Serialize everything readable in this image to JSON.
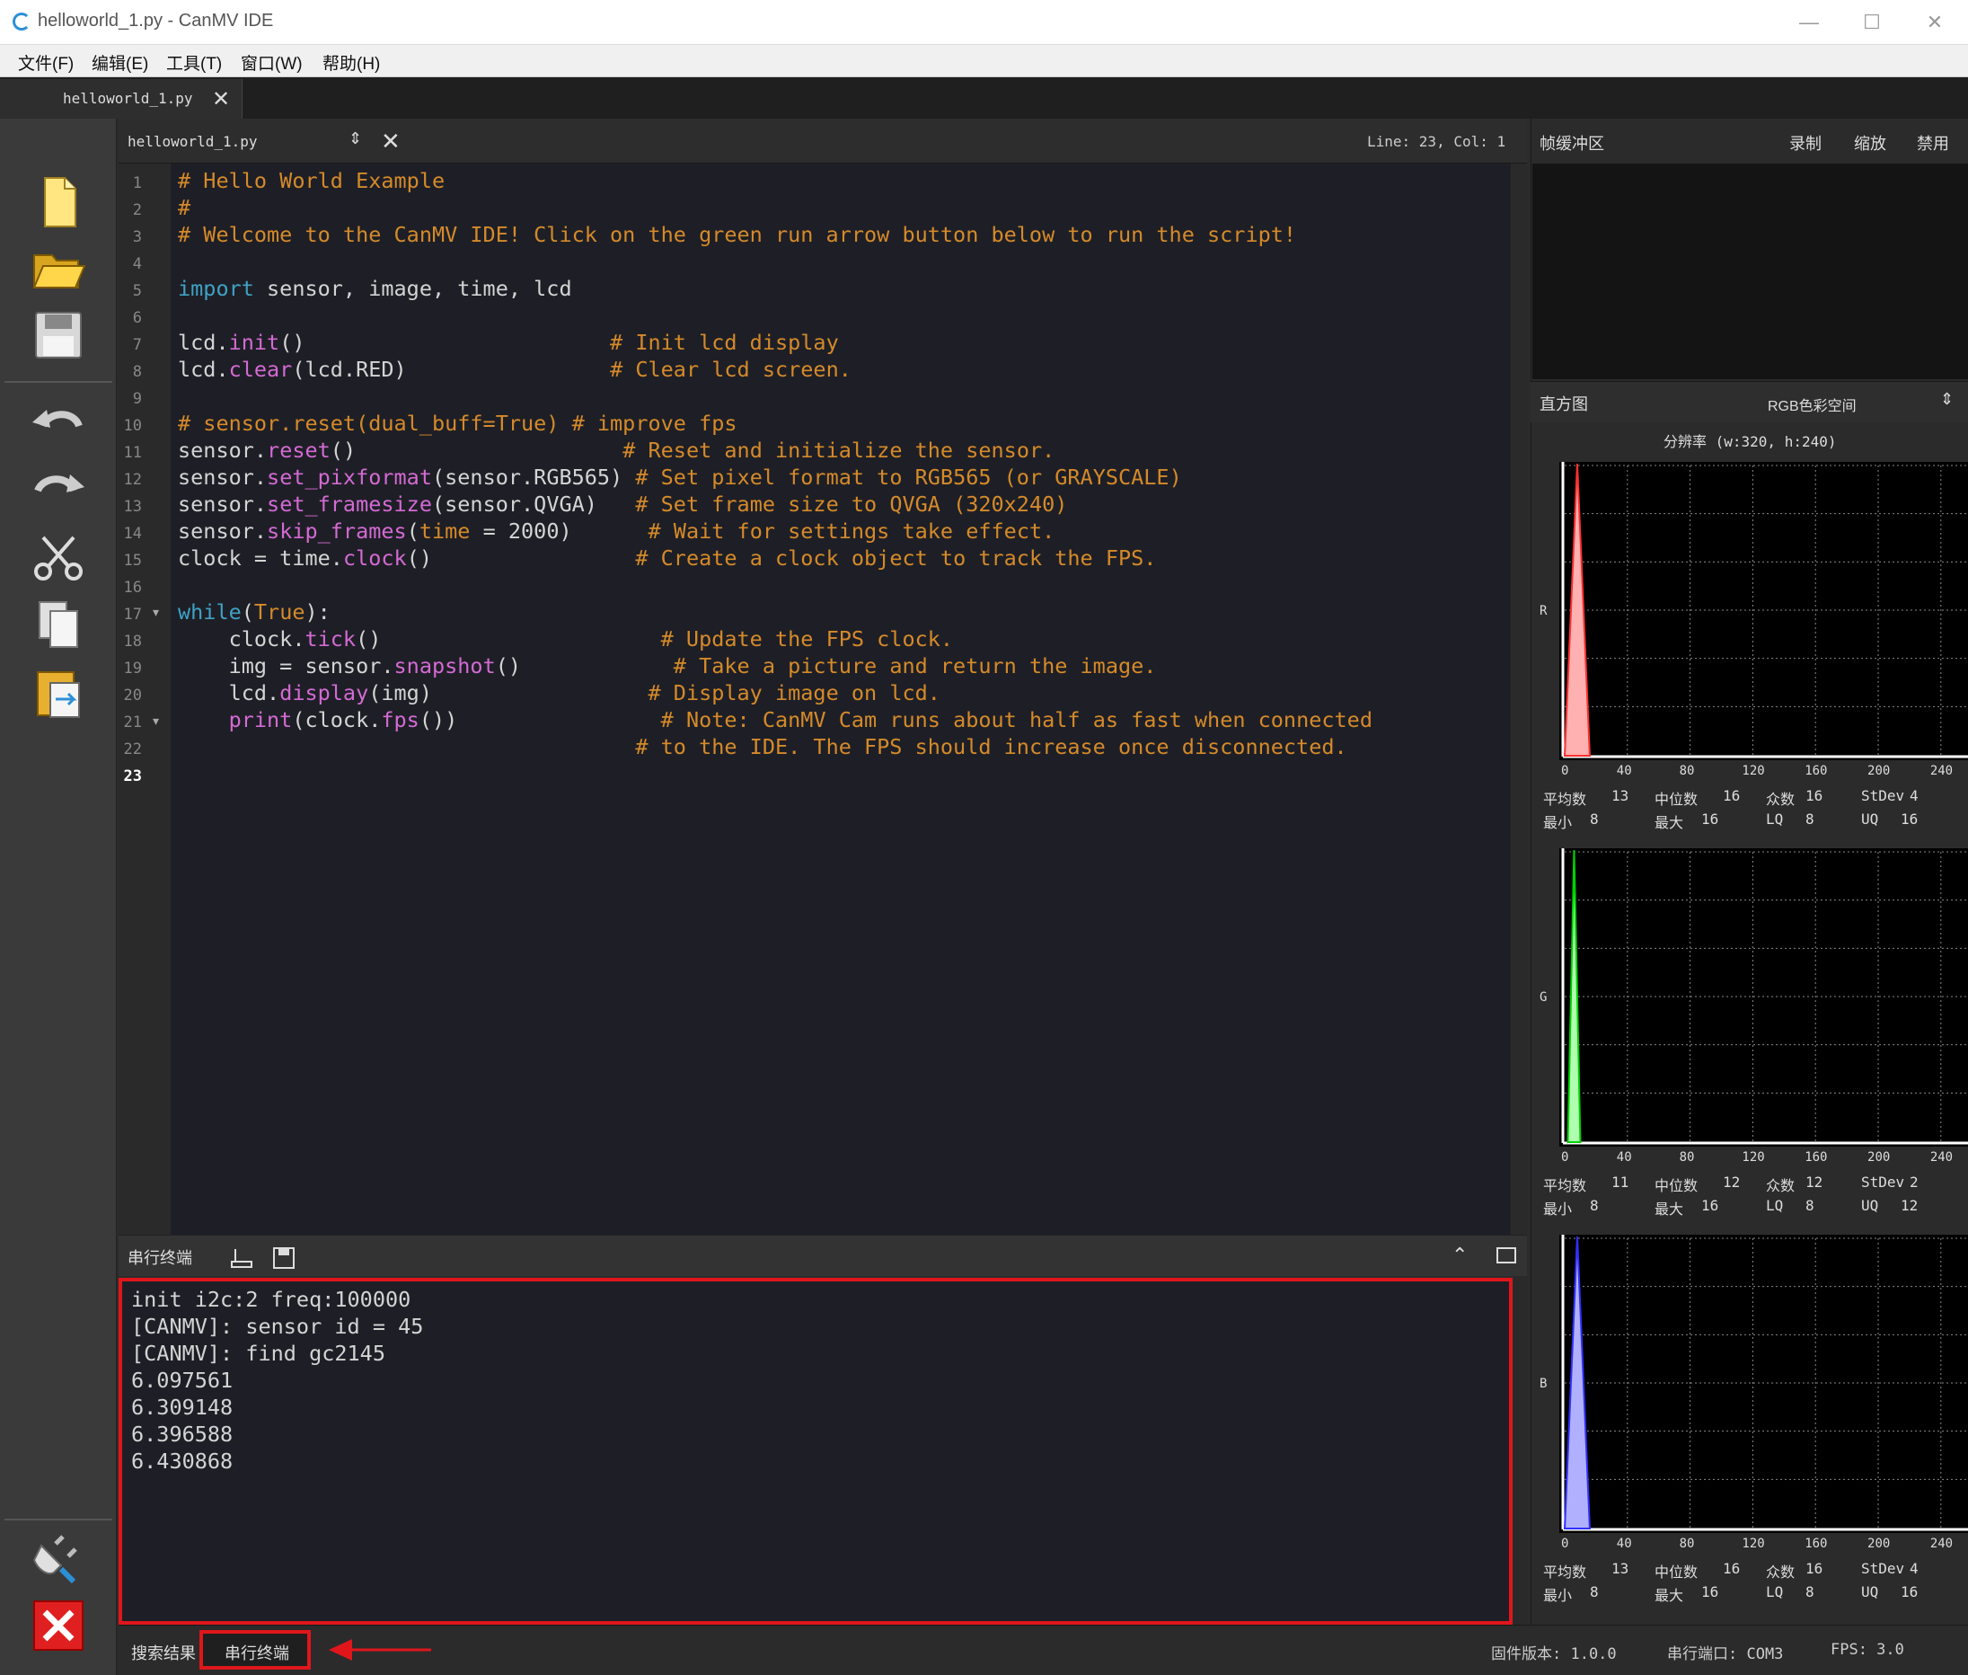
{
  "window": {
    "title": "helloworld_1.py - CanMV IDE"
  },
  "menu": [
    "文件(F)",
    "编辑(E)",
    "工具(T)",
    "窗口(W)",
    "帮助(H)"
  ],
  "tab": {
    "label": "helloworld_1.py"
  },
  "editor": {
    "file": "helloworld_1.py",
    "position": "Line: 23, Col: 1",
    "line_numbers": [
      "1",
      "2",
      "3",
      "4",
      "5",
      "6",
      "7",
      "8",
      "9",
      "10",
      "11",
      "12",
      "13",
      "14",
      "15",
      "16",
      "17",
      "18",
      "19",
      "20",
      "21",
      "22",
      "23"
    ],
    "lines": [
      [
        {
          "t": "# Hello World Example",
          "k": "c"
        }
      ],
      [
        {
          "t": "#",
          "k": "c"
        }
      ],
      [
        {
          "t": "# Welcome to the CanMV IDE! Click on the green run arrow button below to run the script!",
          "k": "c"
        }
      ],
      [],
      [
        {
          "t": "import",
          "k": "k"
        },
        {
          "t": " sensor, image, time, lcd",
          "k": "d"
        }
      ],
      [],
      [
        {
          "t": "lcd.",
          "k": "d"
        },
        {
          "t": "init",
          "k": "f"
        },
        {
          "t": "()                        ",
          "k": "d"
        },
        {
          "t": "# Init lcd display",
          "k": "c"
        }
      ],
      [
        {
          "t": "lcd.",
          "k": "d"
        },
        {
          "t": "clear",
          "k": "f"
        },
        {
          "t": "(lcd.RED)                ",
          "k": "d"
        },
        {
          "t": "# Clear lcd screen.",
          "k": "c"
        }
      ],
      [],
      [
        {
          "t": "# sensor.reset(dual_buff=True) # improve fps",
          "k": "c"
        }
      ],
      [
        {
          "t": "sensor.",
          "k": "d"
        },
        {
          "t": "reset",
          "k": "f"
        },
        {
          "t": "()                     ",
          "k": "d"
        },
        {
          "t": "# Reset and initialize the sensor.",
          "k": "c"
        }
      ],
      [
        {
          "t": "sensor.",
          "k": "d"
        },
        {
          "t": "set_pixformat",
          "k": "f"
        },
        {
          "t": "(sensor.RGB565) ",
          "k": "d"
        },
        {
          "t": "# Set pixel format to RGB565 (or GRAYSCALE)",
          "k": "c"
        }
      ],
      [
        {
          "t": "sensor.",
          "k": "d"
        },
        {
          "t": "set_framesize",
          "k": "f"
        },
        {
          "t": "(sensor.QVGA)   ",
          "k": "d"
        },
        {
          "t": "# Set frame size to QVGA (320x240)",
          "k": "c"
        }
      ],
      [
        {
          "t": "sensor.",
          "k": "d"
        },
        {
          "t": "skip_frames",
          "k": "f"
        },
        {
          "t": "(",
          "k": "d"
        },
        {
          "t": "time",
          "k": "n"
        },
        {
          "t": " = 2000)      ",
          "k": "d"
        },
        {
          "t": "# Wait for settings take effect.",
          "k": "c"
        }
      ],
      [
        {
          "t": "clock = time.",
          "k": "d"
        },
        {
          "t": "clock",
          "k": "f"
        },
        {
          "t": "()                ",
          "k": "d"
        },
        {
          "t": "# Create a clock object to track the FPS.",
          "k": "c"
        }
      ],
      [],
      [
        {
          "t": "while",
          "k": "k"
        },
        {
          "t": "(",
          "k": "d"
        },
        {
          "t": "True",
          "k": "n"
        },
        {
          "t": "):",
          "k": "d"
        }
      ],
      [
        {
          "t": "    clock.",
          "k": "d"
        },
        {
          "t": "tick",
          "k": "f"
        },
        {
          "t": "()                      ",
          "k": "d"
        },
        {
          "t": "# Update the FPS clock.",
          "k": "c"
        }
      ],
      [
        {
          "t": "    img = sensor.",
          "k": "d"
        },
        {
          "t": "snapshot",
          "k": "f"
        },
        {
          "t": "()            ",
          "k": "d"
        },
        {
          "t": "# Take a picture and return the image.",
          "k": "c"
        }
      ],
      [
        {
          "t": "    lcd.",
          "k": "d"
        },
        {
          "t": "display",
          "k": "f"
        },
        {
          "t": "(img)                 ",
          "k": "d"
        },
        {
          "t": "# Display image on lcd.",
          "k": "c"
        }
      ],
      [
        {
          "t": "    ",
          "k": "d"
        },
        {
          "t": "print",
          "k": "f"
        },
        {
          "t": "(clock.",
          "k": "d"
        },
        {
          "t": "fps",
          "k": "f"
        },
        {
          "t": "())                ",
          "k": "d"
        },
        {
          "t": "# Note: CanMV Cam runs about half as fast when connected",
          "k": "c"
        }
      ],
      [
        {
          "t": "                                    ",
          "k": "d"
        },
        {
          "t": "# to the IDE. The FPS should increase once disconnected.",
          "k": "c"
        }
      ],
      []
    ]
  },
  "terminal": {
    "label": "串行终端",
    "lines": [
      "init i2c:2 freq:100000",
      "[CANMV]: sensor id = 45",
      "[CANMV]: find gc2145",
      "6.097561",
      "6.309148",
      "6.396588",
      "6.430868"
    ]
  },
  "statusbar": {
    "search": "搜索结果",
    "serial": "串行终端",
    "firmware": "固件版本: 1.0.0",
    "port": "串行端口: COM3",
    "fps": "FPS:  3.0"
  },
  "framebuffer": {
    "label": "帧缓冲区",
    "record": "录制",
    "zoom": "缩放",
    "disable": "禁用"
  },
  "histogram": {
    "label": "直方图",
    "colorspace": "RGB色彩空间",
    "resolution": "分辨率 (w:320, h:240)",
    "x_ticks": [
      "0",
      "40",
      "80",
      "120",
      "160",
      "200",
      "240"
    ],
    "stat_labels": {
      "mean": "平均数",
      "median": "中位数",
      "mode": "众数",
      "stdev": "StDev",
      "min": "最小",
      "max": "最大",
      "lq": "LQ",
      "uq": "UQ"
    },
    "channels": [
      {
        "name": "R",
        "color": "#ff3030",
        "fill": "#ffb0b0",
        "peak_x": 8,
        "base_left": 0,
        "base_right": 16,
        "mean": "13",
        "median": "16",
        "mode": "16",
        "stdev": "4",
        "min": "8",
        "max": "16",
        "lq": "8",
        "uq": "16"
      },
      {
        "name": "G",
        "color": "#00d000",
        "fill": "#b0ffb0",
        "peak_x": 6,
        "base_left": 2,
        "base_right": 10,
        "mean": "11",
        "median": "12",
        "mode": "12",
        "stdev": "2",
        "min": "8",
        "max": "16",
        "lq": "8",
        "uq": "12"
      },
      {
        "name": "B",
        "color": "#3030ff",
        "fill": "#b0b0ff",
        "peak_x": 8,
        "base_left": 0,
        "base_right": 16,
        "mean": "13",
        "median": "16",
        "mode": "16",
        "stdev": "4",
        "min": "8",
        "max": "16",
        "lq": "8",
        "uq": "16"
      }
    ]
  }
}
